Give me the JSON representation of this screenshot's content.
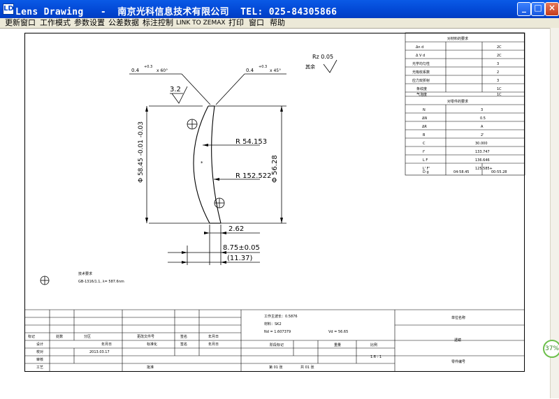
{
  "window": {
    "title": "Lens Drawing   -  南京光科信息技术有限公司  TEL: 025-84305866",
    "minimize": "_",
    "maximize": "□",
    "close": "×"
  },
  "menu": [
    "更新窗口",
    "工作模式",
    "参数设置",
    "公差数据",
    "标注控制",
    "LINK TO ZEMAX",
    "打印",
    "窗口",
    "帮助"
  ],
  "drawing": {
    "chamfer_left": "0.4",
    "chamfer_left_tol": "+0.3",
    "chamfer_left_angle": "x 60°",
    "chamfer_right": "0.4",
    "chamfer_right_tol": "+0.3",
    "chamfer_right_angle": "x 45°",
    "roughness_global": "Rz 0.05",
    "roughness_rest": "其余",
    "roughness_left": "3.2",
    "diameter_outer": "Φ 58.45 -0.01 -0.03",
    "diameter_inner": "Φ 56.28",
    "radius_1": "R 54.153",
    "radius_2": "R 152.522",
    "edge_thickness": "2.62",
    "center_thickness": "8.75±0.05",
    "total_thickness": "(11.37)",
    "spec_title": "技术要求",
    "spec_text": "GB-1316/1.1, λ= 587.6nm"
  },
  "material_table": {
    "title": "对材料的要求",
    "rows": [
      [
        "Δn d",
        "2C"
      ],
      [
        "Δ V d",
        "2C"
      ],
      [
        "光学均匀性",
        "3"
      ],
      [
        "光吸收系数",
        "2"
      ],
      [
        "应力双折射",
        "3"
      ],
      [
        "条纹度",
        "1C"
      ],
      [
        "气泡度",
        "1C"
      ]
    ]
  },
  "part_table": {
    "title": "对零件的要求",
    "rows": [
      [
        "N",
        "3"
      ],
      [
        "ΔN",
        "0.5"
      ],
      [
        "ΔR",
        "A"
      ],
      [
        "B",
        "2'"
      ],
      [
        "C",
        "30.000"
      ],
      [
        "f'",
        "133.747"
      ],
      [
        "L F",
        "136.646"
      ],
      [
        "L' F'",
        "125.585+"
      ],
      [
        "D g",
        "04-58.45",
        "00-55.28"
      ]
    ]
  },
  "title_block": {
    "left_rows": [
      [
        "标记",
        "处数",
        "分区",
        "更改文件号",
        "签名",
        "年月日"
      ],
      [
        "设计",
        "",
        "年月日",
        "标准化",
        "签名",
        "年月日"
      ],
      [
        "校对",
        "",
        "2013.03.17",
        "",
        "",
        ""
      ],
      [
        "审核",
        "",
        "",
        "",
        "",
        ""
      ],
      [
        "工艺",
        "",
        "",
        "批准",
        "",
        ""
      ]
    ],
    "wavelength": "工作主波长：0.5876",
    "material": "材料：SK2",
    "nd": "Nd = 1.607379",
    "vd": "Vd = 56.65",
    "mid_headers": [
      "阶段标记",
      "重量",
      "比例"
    ],
    "scale": "1.6 : 1",
    "sheets": [
      "第 01 张",
      "共 01 张"
    ],
    "unit": "单位名称",
    "part_name": "透镜",
    "part_no": "零件编号"
  },
  "zoom": "37%"
}
